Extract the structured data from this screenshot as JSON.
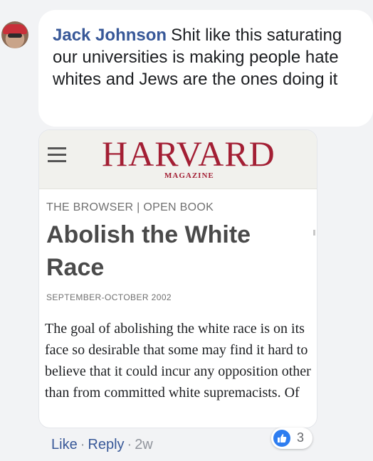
{
  "comment": {
    "author": "Jack Johnson",
    "text": "Shit like this saturating our universities is making people hate whites and Jews are the ones doing it"
  },
  "link_card": {
    "masthead": "HARVARD",
    "masthead_sub": "MAGAZINE",
    "section": "THE BROWSER | OPEN BOOK",
    "title": "Abolish the White Race",
    "date": "SEPTEMBER-OCTOBER 2002",
    "excerpt": "The goal of abolishing the white race is on its face so desirable that some may find it hard to believe that it could incur any opposition other than from committed white supremacists. Of"
  },
  "actions": {
    "like_label": "Like",
    "reply_label": "Reply",
    "separator": "·",
    "time": "2w"
  },
  "reactions": {
    "count": "3",
    "icon": "thumbs-up-icon",
    "color": "#2e7df0"
  },
  "colors": {
    "author_link": "#385898",
    "brand_crimson": "#a31f34",
    "page_background": "#f2f3f5"
  }
}
